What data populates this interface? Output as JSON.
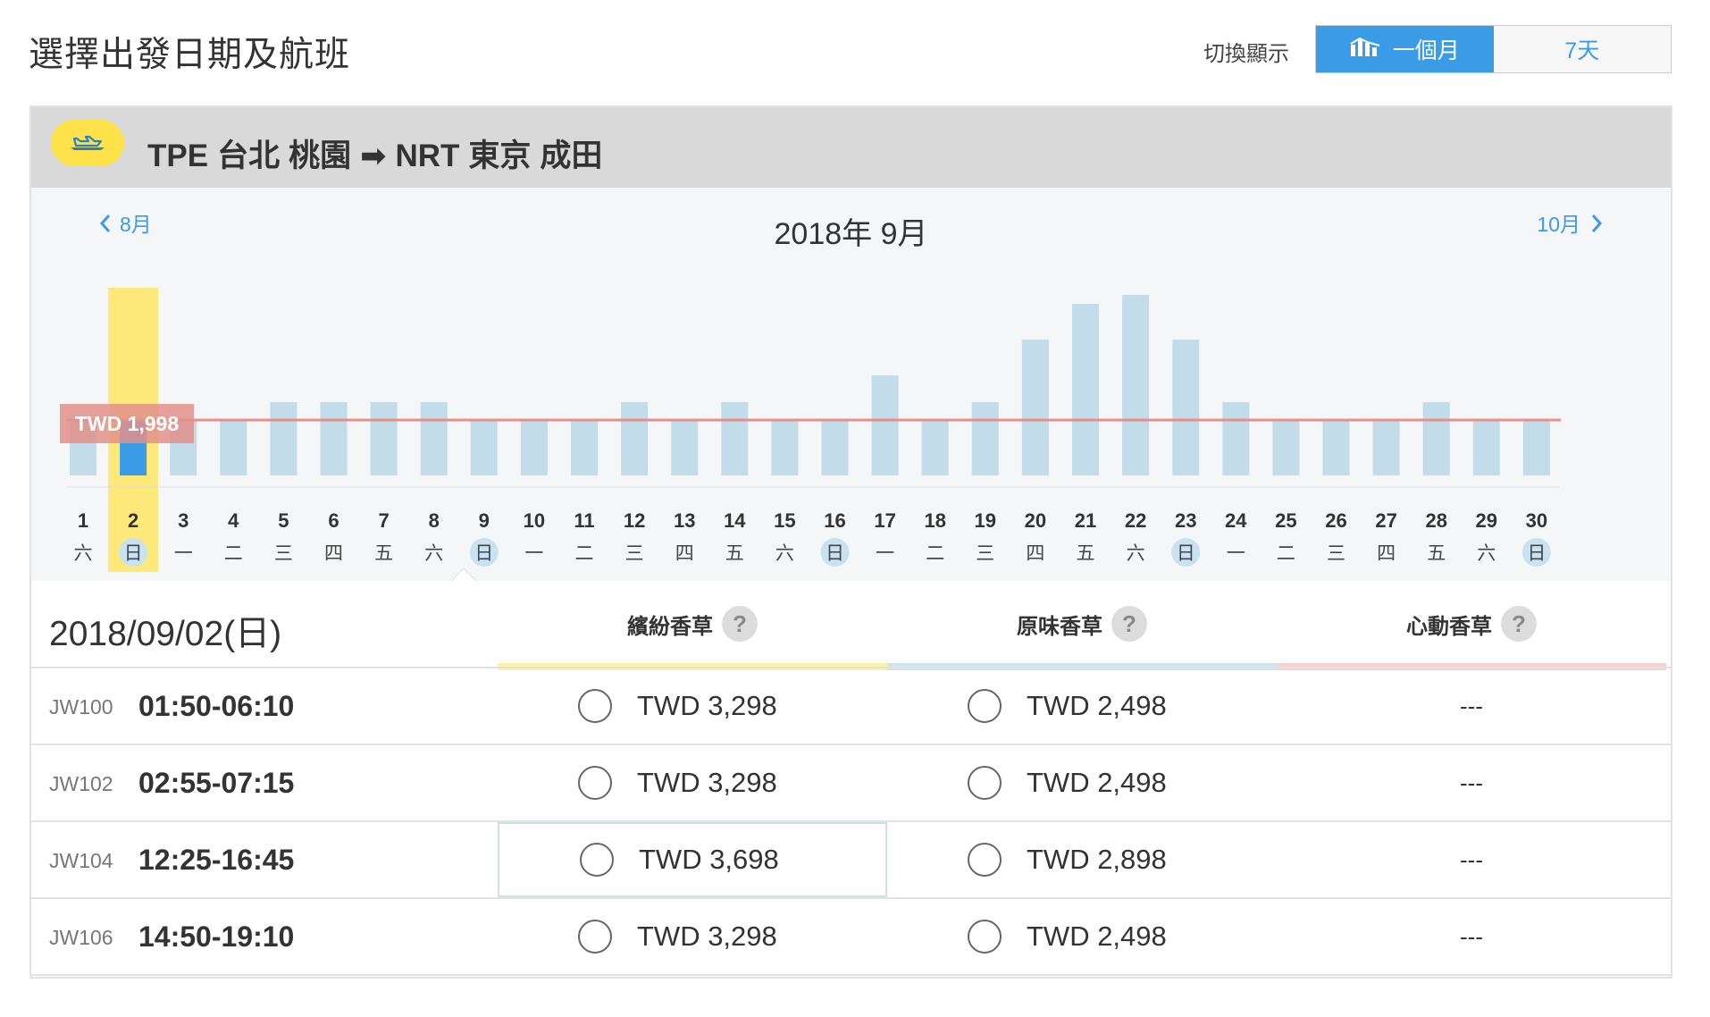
{
  "page_title": "選擇出發日期及航班",
  "view_toggle": {
    "label": "切換顯示",
    "options": [
      {
        "label": "一個月",
        "active": true
      },
      {
        "label": "7天",
        "active": false
      }
    ]
  },
  "route": {
    "origin_code": "TPE",
    "origin_city": "台北",
    "origin_airport": "桃園",
    "arrow": "➡",
    "dest_code": "NRT",
    "dest_city": "東京",
    "dest_airport": "成田"
  },
  "calendar": {
    "prev_month": "8月",
    "next_month": "10月",
    "month_title": "2018年 9月",
    "selected_day": 2,
    "lowest_price_label": "TWD 1,998",
    "days": [
      {
        "day": "1",
        "wd": "六",
        "price": 1998,
        "sunday": false
      },
      {
        "day": "2",
        "wd": "日",
        "price": 1998,
        "sunday": true
      },
      {
        "day": "3",
        "wd": "一",
        "price": 1998,
        "sunday": false
      },
      {
        "day": "4",
        "wd": "二",
        "price": 1998,
        "sunday": false
      },
      {
        "day": "5",
        "wd": "三",
        "price": 2198,
        "sunday": false
      },
      {
        "day": "6",
        "wd": "四",
        "price": 2198,
        "sunday": false
      },
      {
        "day": "7",
        "wd": "五",
        "price": 2198,
        "sunday": false
      },
      {
        "day": "8",
        "wd": "六",
        "price": 2198,
        "sunday": false
      },
      {
        "day": "9",
        "wd": "日",
        "price": 1998,
        "sunday": true
      },
      {
        "day": "10",
        "wd": "一",
        "price": 1998,
        "sunday": false
      },
      {
        "day": "11",
        "wd": "二",
        "price": 1998,
        "sunday": false
      },
      {
        "day": "12",
        "wd": "三",
        "price": 2198,
        "sunday": false
      },
      {
        "day": "13",
        "wd": "四",
        "price": 1998,
        "sunday": false
      },
      {
        "day": "14",
        "wd": "五",
        "price": 2198,
        "sunday": false
      },
      {
        "day": "15",
        "wd": "六",
        "price": 1998,
        "sunday": false
      },
      {
        "day": "16",
        "wd": "日",
        "price": 1998,
        "sunday": true
      },
      {
        "day": "17",
        "wd": "一",
        "price": 2498,
        "sunday": false
      },
      {
        "day": "18",
        "wd": "二",
        "price": 1998,
        "sunday": false
      },
      {
        "day": "19",
        "wd": "三",
        "price": 2198,
        "sunday": false
      },
      {
        "day": "20",
        "wd": "四",
        "price": 2898,
        "sunday": false
      },
      {
        "day": "21",
        "wd": "五",
        "price": 3298,
        "sunday": false
      },
      {
        "day": "22",
        "wd": "六",
        "price": 3398,
        "sunday": false
      },
      {
        "day": "23",
        "wd": "日",
        "price": 2898,
        "sunday": true
      },
      {
        "day": "24",
        "wd": "一",
        "price": 2198,
        "sunday": false
      },
      {
        "day": "25",
        "wd": "二",
        "price": 1998,
        "sunday": false
      },
      {
        "day": "26",
        "wd": "三",
        "price": 1998,
        "sunday": false
      },
      {
        "day": "27",
        "wd": "四",
        "price": 1998,
        "sunday": false
      },
      {
        "day": "28",
        "wd": "五",
        "price": 2198,
        "sunday": false
      },
      {
        "day": "29",
        "wd": "六",
        "price": 1998,
        "sunday": false
      },
      {
        "day": "30",
        "wd": "日",
        "price": 1998,
        "sunday": true
      }
    ]
  },
  "flights": {
    "date_header": "2018/09/02(日)",
    "fare_classes": [
      {
        "name": "繽紛香草",
        "help": "?",
        "color": "#fdf29e"
      },
      {
        "name": "原味香草",
        "help": "?",
        "color": "#cfe4f1"
      },
      {
        "name": "心動香草",
        "help": "?",
        "color": "#f8d2d0"
      }
    ],
    "rows": [
      {
        "code": "JW100",
        "time": "01:50-06:10",
        "fares": [
          "TWD 3,298",
          "TWD 2,498",
          "---"
        ]
      },
      {
        "code": "JW102",
        "time": "02:55-07:15",
        "fares": [
          "TWD 3,298",
          "TWD 2,498",
          "---"
        ]
      },
      {
        "code": "JW104",
        "time": "12:25-16:45",
        "fares": [
          "TWD 3,698",
          "TWD 2,898",
          "---"
        ]
      },
      {
        "code": "JW106",
        "time": "14:50-19:10",
        "fares": [
          "TWD 3,298",
          "TWD 2,498",
          "---"
        ]
      }
    ]
  },
  "colors": {
    "accent": "#3a9be6",
    "bar": "#c2dce9",
    "bar_selected": "#3a9be6",
    "highlight": "#fde87a",
    "low_line": "#e3918b",
    "sunday_circle": "#c9e2f2"
  }
}
